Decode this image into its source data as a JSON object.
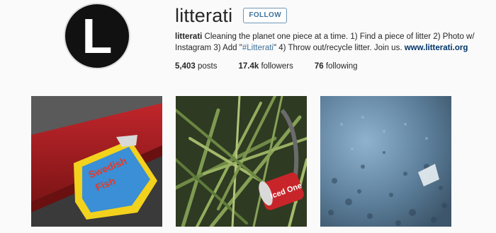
{
  "profile": {
    "avatar_letter": "L",
    "username": "litterati",
    "follow_label": "FOLLOW",
    "bio": {
      "name": "litterati",
      "text_part1": " Cleaning the planet one piece at a time. 1) Find a piece of litter 2) Photo w/ Instagram 3) Add \"",
      "hashtag": "#Litterati",
      "text_part2": "\" 4) Throw out/recycle litter. Join us. ",
      "link": "www.litterati.org"
    },
    "stats": {
      "posts_count": "5,403",
      "posts_label": " posts",
      "followers_count": "17.4k",
      "followers_label": " followers",
      "following_count": "76",
      "following_label": " following"
    }
  },
  "photos": [
    {
      "description_icon": "litter-candy-wrapper-photo"
    },
    {
      "description_icon": "litter-soda-can-photo"
    },
    {
      "description_icon": "litter-gravel-photo"
    }
  ],
  "colors": {
    "link": "#003569",
    "hashtag": "#3f729b",
    "follow_border": "#6f97b6"
  }
}
